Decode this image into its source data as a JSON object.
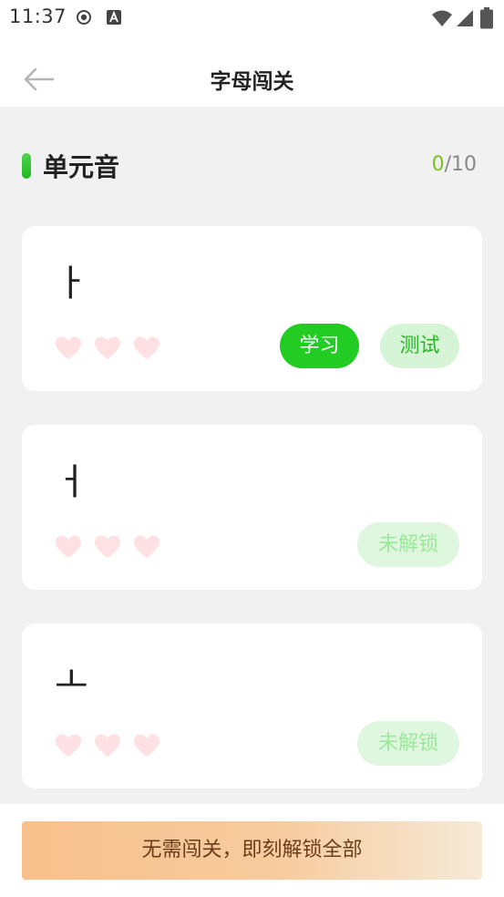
{
  "status_bar": {
    "time": "11:37",
    "icons": [
      "record-icon",
      "a-text-icon",
      "wifi-icon",
      "signal-icon",
      "battery-icon"
    ]
  },
  "nav": {
    "title": "字母闯关",
    "back_icon": "arrow-left-icon"
  },
  "section": {
    "title": "单元音",
    "progress_done": "0",
    "progress_total": "/10",
    "accent_color": "#23cc23"
  },
  "cards": [
    {
      "letter": "ㅏ",
      "hearts": 3,
      "buttons": {
        "study": "学习",
        "test": "测试"
      }
    },
    {
      "letter": "ㅓ",
      "hearts": 3,
      "locked_label": "未解锁"
    },
    {
      "letter": "ㅗ",
      "hearts": 3,
      "locked_label": "未解锁"
    }
  ],
  "bottom": {
    "unlock_all_label": "无需闯关，即刻解锁全部"
  },
  "colors": {
    "primary_green": "#23cc23",
    "light_green": "#d6f5d6",
    "heart_pink": "#ffe0e3",
    "unlock_gradient_start": "#f7c08c",
    "unlock_gradient_end": "#f6ead8"
  }
}
